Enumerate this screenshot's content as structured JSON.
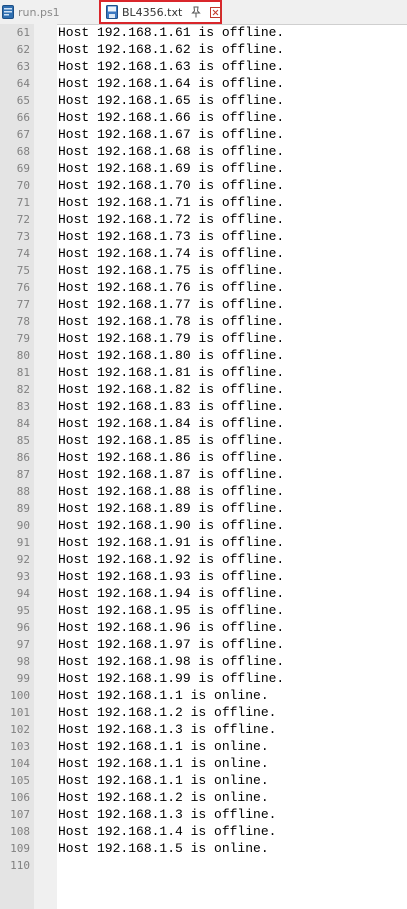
{
  "tabs": [
    {
      "label": "run.ps1",
      "active": false
    },
    {
      "label": "BL4356.txt",
      "active": true
    }
  ],
  "colors": {
    "active_tab_outline": "#d9262b"
  },
  "editor": {
    "lines": [
      {
        "n": "61",
        "text": "Host 192.168.1.61 is offline."
      },
      {
        "n": "62",
        "text": "Host 192.168.1.62 is offline."
      },
      {
        "n": "63",
        "text": "Host 192.168.1.63 is offline."
      },
      {
        "n": "64",
        "text": "Host 192.168.1.64 is offline."
      },
      {
        "n": "65",
        "text": "Host 192.168.1.65 is offline."
      },
      {
        "n": "66",
        "text": "Host 192.168.1.66 is offline."
      },
      {
        "n": "67",
        "text": "Host 192.168.1.67 is offline."
      },
      {
        "n": "68",
        "text": "Host 192.168.1.68 is offline."
      },
      {
        "n": "69",
        "text": "Host 192.168.1.69 is offline."
      },
      {
        "n": "70",
        "text": "Host 192.168.1.70 is offline."
      },
      {
        "n": "71",
        "text": "Host 192.168.1.71 is offline."
      },
      {
        "n": "72",
        "text": "Host 192.168.1.72 is offline."
      },
      {
        "n": "73",
        "text": "Host 192.168.1.73 is offline."
      },
      {
        "n": "74",
        "text": "Host 192.168.1.74 is offline."
      },
      {
        "n": "75",
        "text": "Host 192.168.1.75 is offline."
      },
      {
        "n": "76",
        "text": "Host 192.168.1.76 is offline."
      },
      {
        "n": "77",
        "text": "Host 192.168.1.77 is offline."
      },
      {
        "n": "78",
        "text": "Host 192.168.1.78 is offline."
      },
      {
        "n": "79",
        "text": "Host 192.168.1.79 is offline."
      },
      {
        "n": "80",
        "text": "Host 192.168.1.80 is offline."
      },
      {
        "n": "81",
        "text": "Host 192.168.1.81 is offline."
      },
      {
        "n": "82",
        "text": "Host 192.168.1.82 is offline."
      },
      {
        "n": "83",
        "text": "Host 192.168.1.83 is offline."
      },
      {
        "n": "84",
        "text": "Host 192.168.1.84 is offline."
      },
      {
        "n": "85",
        "text": "Host 192.168.1.85 is offline."
      },
      {
        "n": "86",
        "text": "Host 192.168.1.86 is offline."
      },
      {
        "n": "87",
        "text": "Host 192.168.1.87 is offline."
      },
      {
        "n": "88",
        "text": "Host 192.168.1.88 is offline."
      },
      {
        "n": "89",
        "text": "Host 192.168.1.89 is offline."
      },
      {
        "n": "90",
        "text": "Host 192.168.1.90 is offline."
      },
      {
        "n": "91",
        "text": "Host 192.168.1.91 is offline."
      },
      {
        "n": "92",
        "text": "Host 192.168.1.92 is offline."
      },
      {
        "n": "93",
        "text": "Host 192.168.1.93 is offline."
      },
      {
        "n": "94",
        "text": "Host 192.168.1.94 is offline."
      },
      {
        "n": "95",
        "text": "Host 192.168.1.95 is offline."
      },
      {
        "n": "96",
        "text": "Host 192.168.1.96 is offline."
      },
      {
        "n": "97",
        "text": "Host 192.168.1.97 is offline."
      },
      {
        "n": "98",
        "text": "Host 192.168.1.98 is offline."
      },
      {
        "n": "99",
        "text": "Host 192.168.1.99 is offline."
      },
      {
        "n": "100",
        "text": "Host 192.168.1.1 is online."
      },
      {
        "n": "101",
        "text": "Host 192.168.1.2 is offline."
      },
      {
        "n": "102",
        "text": "Host 192.168.1.3 is offline."
      },
      {
        "n": "103",
        "text": "Host 192.168.1.1 is online."
      },
      {
        "n": "104",
        "text": "Host 192.168.1.1 is online."
      },
      {
        "n": "105",
        "text": "Host 192.168.1.1 is online."
      },
      {
        "n": "106",
        "text": "Host 192.168.1.2 is online."
      },
      {
        "n": "107",
        "text": "Host 192.168.1.3 is offline."
      },
      {
        "n": "108",
        "text": "Host 192.168.1.4 is offline."
      },
      {
        "n": "109",
        "text": "Host 192.168.1.5 is online."
      },
      {
        "n": "110",
        "text": ""
      }
    ]
  }
}
